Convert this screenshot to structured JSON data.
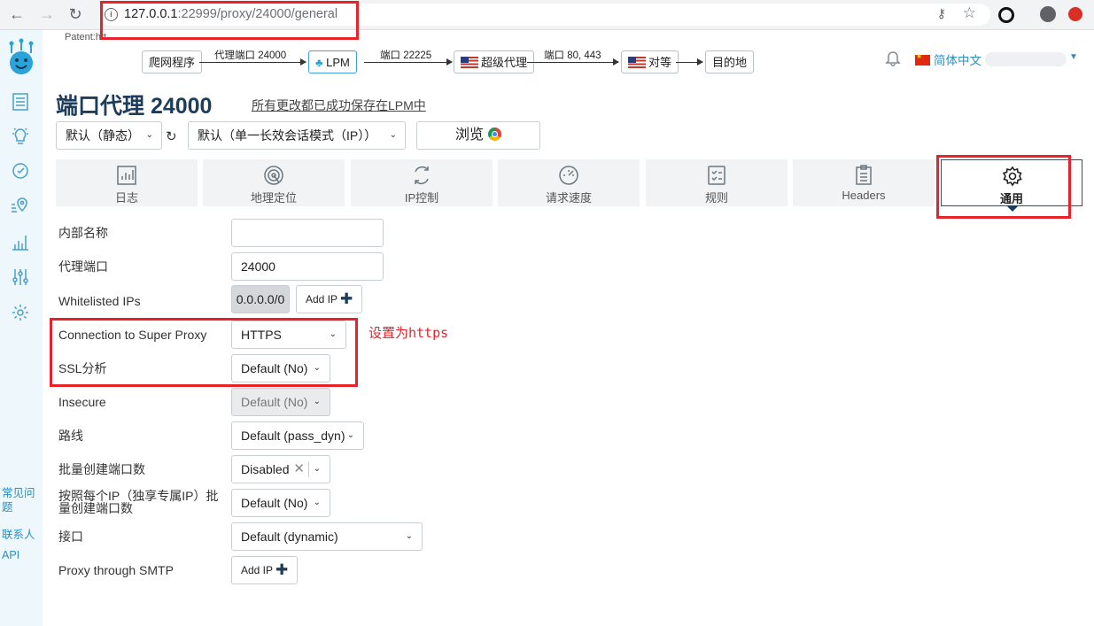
{
  "browser": {
    "url_host": "127.0.0.1",
    "url_rest": ":22999/proxy/24000/general",
    "back": "←",
    "forward": "→",
    "reload": "↻"
  },
  "sidebar": {
    "links": [
      {
        "label": "常见问题"
      },
      {
        "label": "联系人"
      },
      {
        "label": "API"
      }
    ]
  },
  "header": {
    "patent": "Patent:htt",
    "flow": {
      "crawler": "爬网程序",
      "proxy_port_label": "代理端口 24000",
      "lpm": "LPM",
      "port_label_1": "端口 22225",
      "super_proxy": "超级代理",
      "port_label_2": "端口 80, 443",
      "peer": "对等",
      "destination": "目的地"
    },
    "language": "简体中文"
  },
  "page": {
    "title": "端口代理 24000",
    "saved_msg": "所有更改都已成功保存在LPM中",
    "preset_select": "默认（静态）",
    "session_select": "默认（单一长效会话模式（IP））",
    "browse_label": "浏览"
  },
  "tabs": [
    {
      "label": "日志"
    },
    {
      "label": "地理定位"
    },
    {
      "label": "IP控制"
    },
    {
      "label": "请求速度"
    },
    {
      "label": "规则"
    },
    {
      "label": "Headers"
    },
    {
      "label": "通用"
    }
  ],
  "form": {
    "internal_name": {
      "label": "内部名称",
      "value": ""
    },
    "proxy_port": {
      "label": "代理端口",
      "value": "24000"
    },
    "whitelisted_ips": {
      "label": "Whitelisted IPs",
      "chip": "0.0.0.0/0",
      "add": "Add IP"
    },
    "connection": {
      "label": "Connection to Super Proxy",
      "value": "HTTPS"
    },
    "ssl": {
      "label": "SSL分析",
      "value": "Default (No)"
    },
    "insecure": {
      "label": "Insecure",
      "value": "Default (No)"
    },
    "route": {
      "label": "路线",
      "value": "Default (pass_dyn)"
    },
    "multiply": {
      "label": "批量创建端口数",
      "value": "Disabled"
    },
    "multiply_ip": {
      "label": "按照每个IP（独享专属IP）批量创建端口数",
      "value": "Default (No)"
    },
    "iface": {
      "label": "接口",
      "value": "Default (dynamic)"
    },
    "smtp": {
      "label": "Proxy through SMTP",
      "add": "Add IP"
    }
  },
  "annotation": {
    "note": "设置为https"
  },
  "colors": {
    "accent": "#1d3d5c",
    "link": "#2b8fc2",
    "annotation_red": "#e8222a",
    "sidebar_bg": "#eef7fc"
  }
}
